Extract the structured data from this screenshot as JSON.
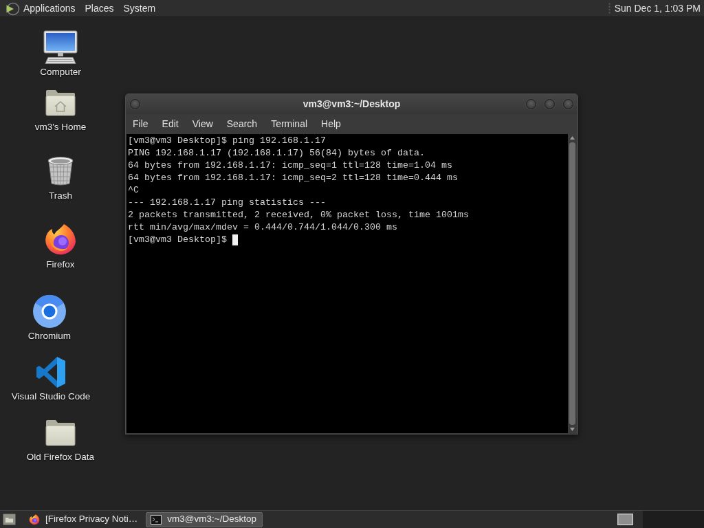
{
  "top_panel": {
    "menus": [
      "Applications",
      "Places",
      "System"
    ],
    "clock": "Sun Dec 1, 1:03 PM"
  },
  "desktop_icons": [
    {
      "label": "Computer",
      "kind": "computer"
    },
    {
      "label": "vm3's Home",
      "kind": "home"
    },
    {
      "label": "Trash",
      "kind": "trash"
    },
    {
      "label": "Firefox",
      "kind": "firefox"
    },
    {
      "label": "Chromium",
      "kind": "chromium"
    },
    {
      "label": "Visual Studio Code",
      "kind": "vscode"
    },
    {
      "label": "Old Firefox Data",
      "kind": "folder"
    }
  ],
  "terminal_window": {
    "title": "vm3@vm3:~/Desktop",
    "menu": [
      "File",
      "Edit",
      "View",
      "Search",
      "Terminal",
      "Help"
    ],
    "lines": [
      "[vm3@vm3 Desktop]$ ping 192.168.1.17",
      "PING 192.168.1.17 (192.168.1.17) 56(84) bytes of data.",
      "64 bytes from 192.168.1.17: icmp_seq=1 ttl=128 time=1.04 ms",
      "64 bytes from 192.168.1.17: icmp_seq=2 ttl=128 time=0.444 ms",
      "^C",
      "--- 192.168.1.17 ping statistics ---",
      "2 packets transmitted, 2 received, 0% packet loss, time 1001ms",
      "rtt min/avg/max/mdev = 0.444/0.744/1.044/0.300 ms",
      "[vm3@vm3 Desktop]$"
    ]
  },
  "taskbar": {
    "windows": [
      {
        "label": "[Firefox Privacy Noti…",
        "kind": "firefox",
        "selected": false
      },
      {
        "label": "vm3@vm3:~/Desktop",
        "kind": "terminal",
        "selected": true
      }
    ]
  }
}
